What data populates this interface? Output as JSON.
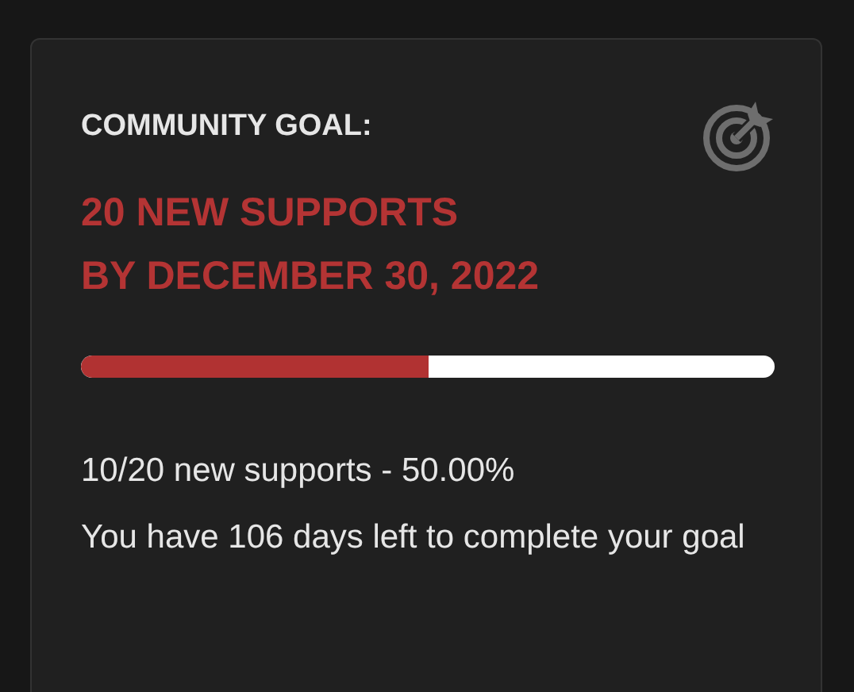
{
  "goal_card": {
    "heading": "COMMUNITY GOAL:",
    "goal_lines": [
      "20 NEW SUPPORTS",
      "BY DECEMBER 30, 2022"
    ],
    "progress": {
      "level": 0.5
    },
    "summary": "10/20 new supports - 50.00%",
    "note": "You have 106 days left to complete your goal"
  }
}
